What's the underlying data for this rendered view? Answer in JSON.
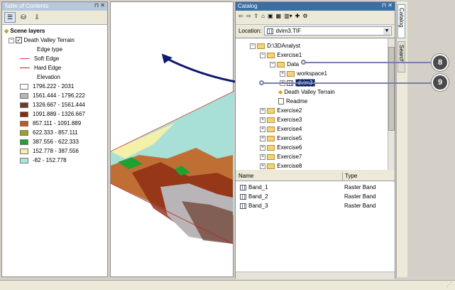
{
  "toc": {
    "title": "Table of Contents",
    "group": "Scene layers",
    "layer": "Death Valley Terrain",
    "edge_type_label": "Edge type",
    "soft_edge": "Soft Edge",
    "hard_edge": "Hard Edge",
    "elevation_label": "Elevation",
    "classes": [
      {
        "label": "1796.222 - 2031",
        "color": "#ffffff"
      },
      {
        "label": "1561.444 - 1796.222",
        "color": "#b8b4b8"
      },
      {
        "label": "1326.667 - 1561.444",
        "color": "#6b3a2a"
      },
      {
        "label": "1091.889 - 1326.667",
        "color": "#8b2a10"
      },
      {
        "label": "857.111 - 1091.889",
        "color": "#c45a18"
      },
      {
        "label": "622.333 - 857.111",
        "color": "#a0a020"
      },
      {
        "label": "387.556 - 622.333",
        "color": "#20a030"
      },
      {
        "label": "152.778 - 387.556",
        "color": "#f5f0a8"
      },
      {
        "label": "-82 - 152.778",
        "color": "#a8e8e0"
      }
    ]
  },
  "catalog": {
    "title": "Catalog",
    "location_label": "Location:",
    "location_value": "dvim3.TIF",
    "tree": {
      "root": "D:\\3DAnalyst",
      "exercise1": "Exercise1",
      "data": "Data",
      "workspace1": "workspace1",
      "dvim3": "dvim3",
      "terrain": "Death Valley Terrain",
      "readme": "Readme",
      "others": [
        "Exercise2",
        "Exercise3",
        "Exercise4",
        "Exercise5",
        "Exercise6",
        "Exercise7",
        "Exercise8"
      ]
    },
    "columns": [
      "Name",
      "Type"
    ],
    "rows": [
      {
        "name": "Band_1",
        "type": "Raster Band"
      },
      {
        "name": "Band_2",
        "type": "Raster Band"
      },
      {
        "name": "Band_3",
        "type": "Raster Band"
      }
    ]
  },
  "side_tabs": [
    "Catalog",
    "Search"
  ],
  "callouts": [
    "8",
    "9"
  ]
}
